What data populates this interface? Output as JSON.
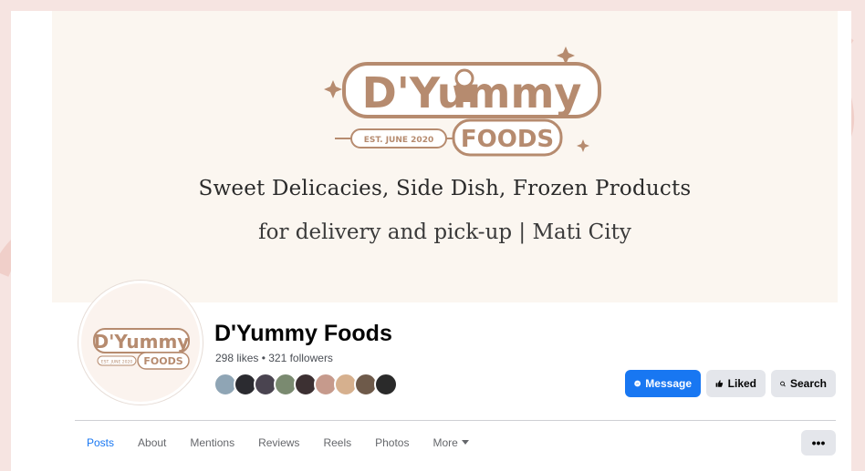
{
  "cover": {
    "logo_main": "D'Yummy",
    "logo_sub": "FOODS",
    "logo_est": "EST. JUNE 2020",
    "tagline_1": "Sweet Delicacies, Side Dish, Frozen Products",
    "tagline_2": "for delivery and pick-up | Mati City"
  },
  "profile": {
    "logo_main": "D'Yummy",
    "logo_sub": "FOODS",
    "logo_est": "EST. JUNE 2020"
  },
  "page": {
    "name": "D'Yummy Foods",
    "stats": "298 likes • 321 followers"
  },
  "followers": [
    "#8fa5b5",
    "#2b2b30",
    "#4a4450",
    "#7a8a70",
    "#3c3032",
    "#c69a8c",
    "#d6b08e",
    "#6e5a4a",
    "#2a2a2a"
  ],
  "actions": {
    "message": "Message",
    "liked": "Liked",
    "search": "Search"
  },
  "tabs": [
    {
      "label": "Posts"
    },
    {
      "label": "About"
    },
    {
      "label": "Mentions"
    },
    {
      "label": "Reviews"
    },
    {
      "label": "Reels"
    },
    {
      "label": "Photos"
    },
    {
      "label": "More"
    }
  ],
  "more_menu": "•••",
  "colors": {
    "brand_blue": "#1877f2",
    "logo_brown": "#b68b6f",
    "button_gray": "#e4e6eb"
  }
}
